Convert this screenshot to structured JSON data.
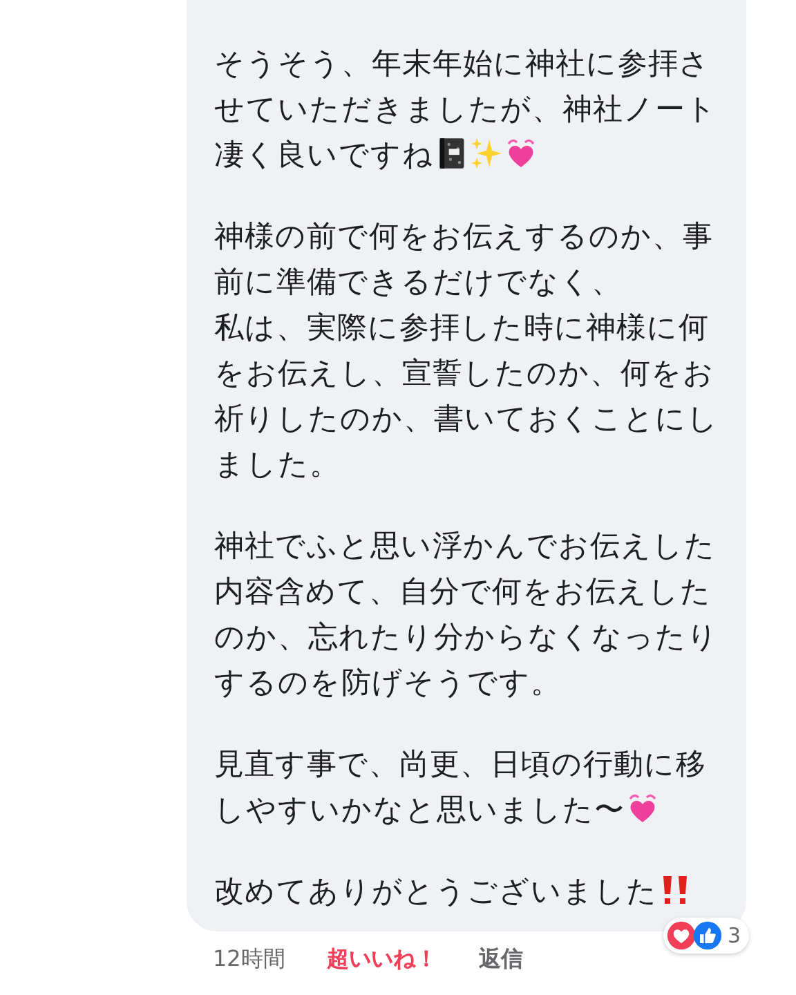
{
  "comment": {
    "blocks": [
      {
        "lines": [
          "そうそう、年末年始に神社に参拝さ",
          "せていただきましたが、神社ノート",
          "凄く良いですね"
        ],
        "emoji": [
          {
            "kind": "notebook"
          },
          {
            "kind": "sparkles"
          },
          {
            "kind": "heart"
          }
        ]
      },
      {
        "lines": [
          "神様の前で何をお伝えするのか、事",
          "前に準備できるだけでなく、",
          "私は、実際に参拝した時に神様に何",
          "をお伝えし、宣誓したのか、何をお",
          "祈りしたのか、書いておくことにし",
          "ました。"
        ]
      },
      {
        "lines": [
          "神社でふと思い浮かんでお伝えした",
          "内容含めて、自分で何をお伝えした",
          "のか、忘れたり分からなくなったり",
          "するのを防げそうです。"
        ]
      },
      {
        "lines": [
          "見直す事で、尚更、日頃の行動に移",
          "しやすいかなと思いました〜"
        ],
        "emoji": [
          {
            "kind": "heart"
          }
        ]
      },
      {
        "lines": [
          "改めてありがとうございました"
        ],
        "emoji": [
          {
            "kind": "exclamation"
          }
        ]
      }
    ],
    "reactions": {
      "count": "3"
    },
    "footer": {
      "time": "12時間",
      "reaction": {
        "label": "超いいね！",
        "selected": true
      },
      "reply": "返信"
    }
  }
}
